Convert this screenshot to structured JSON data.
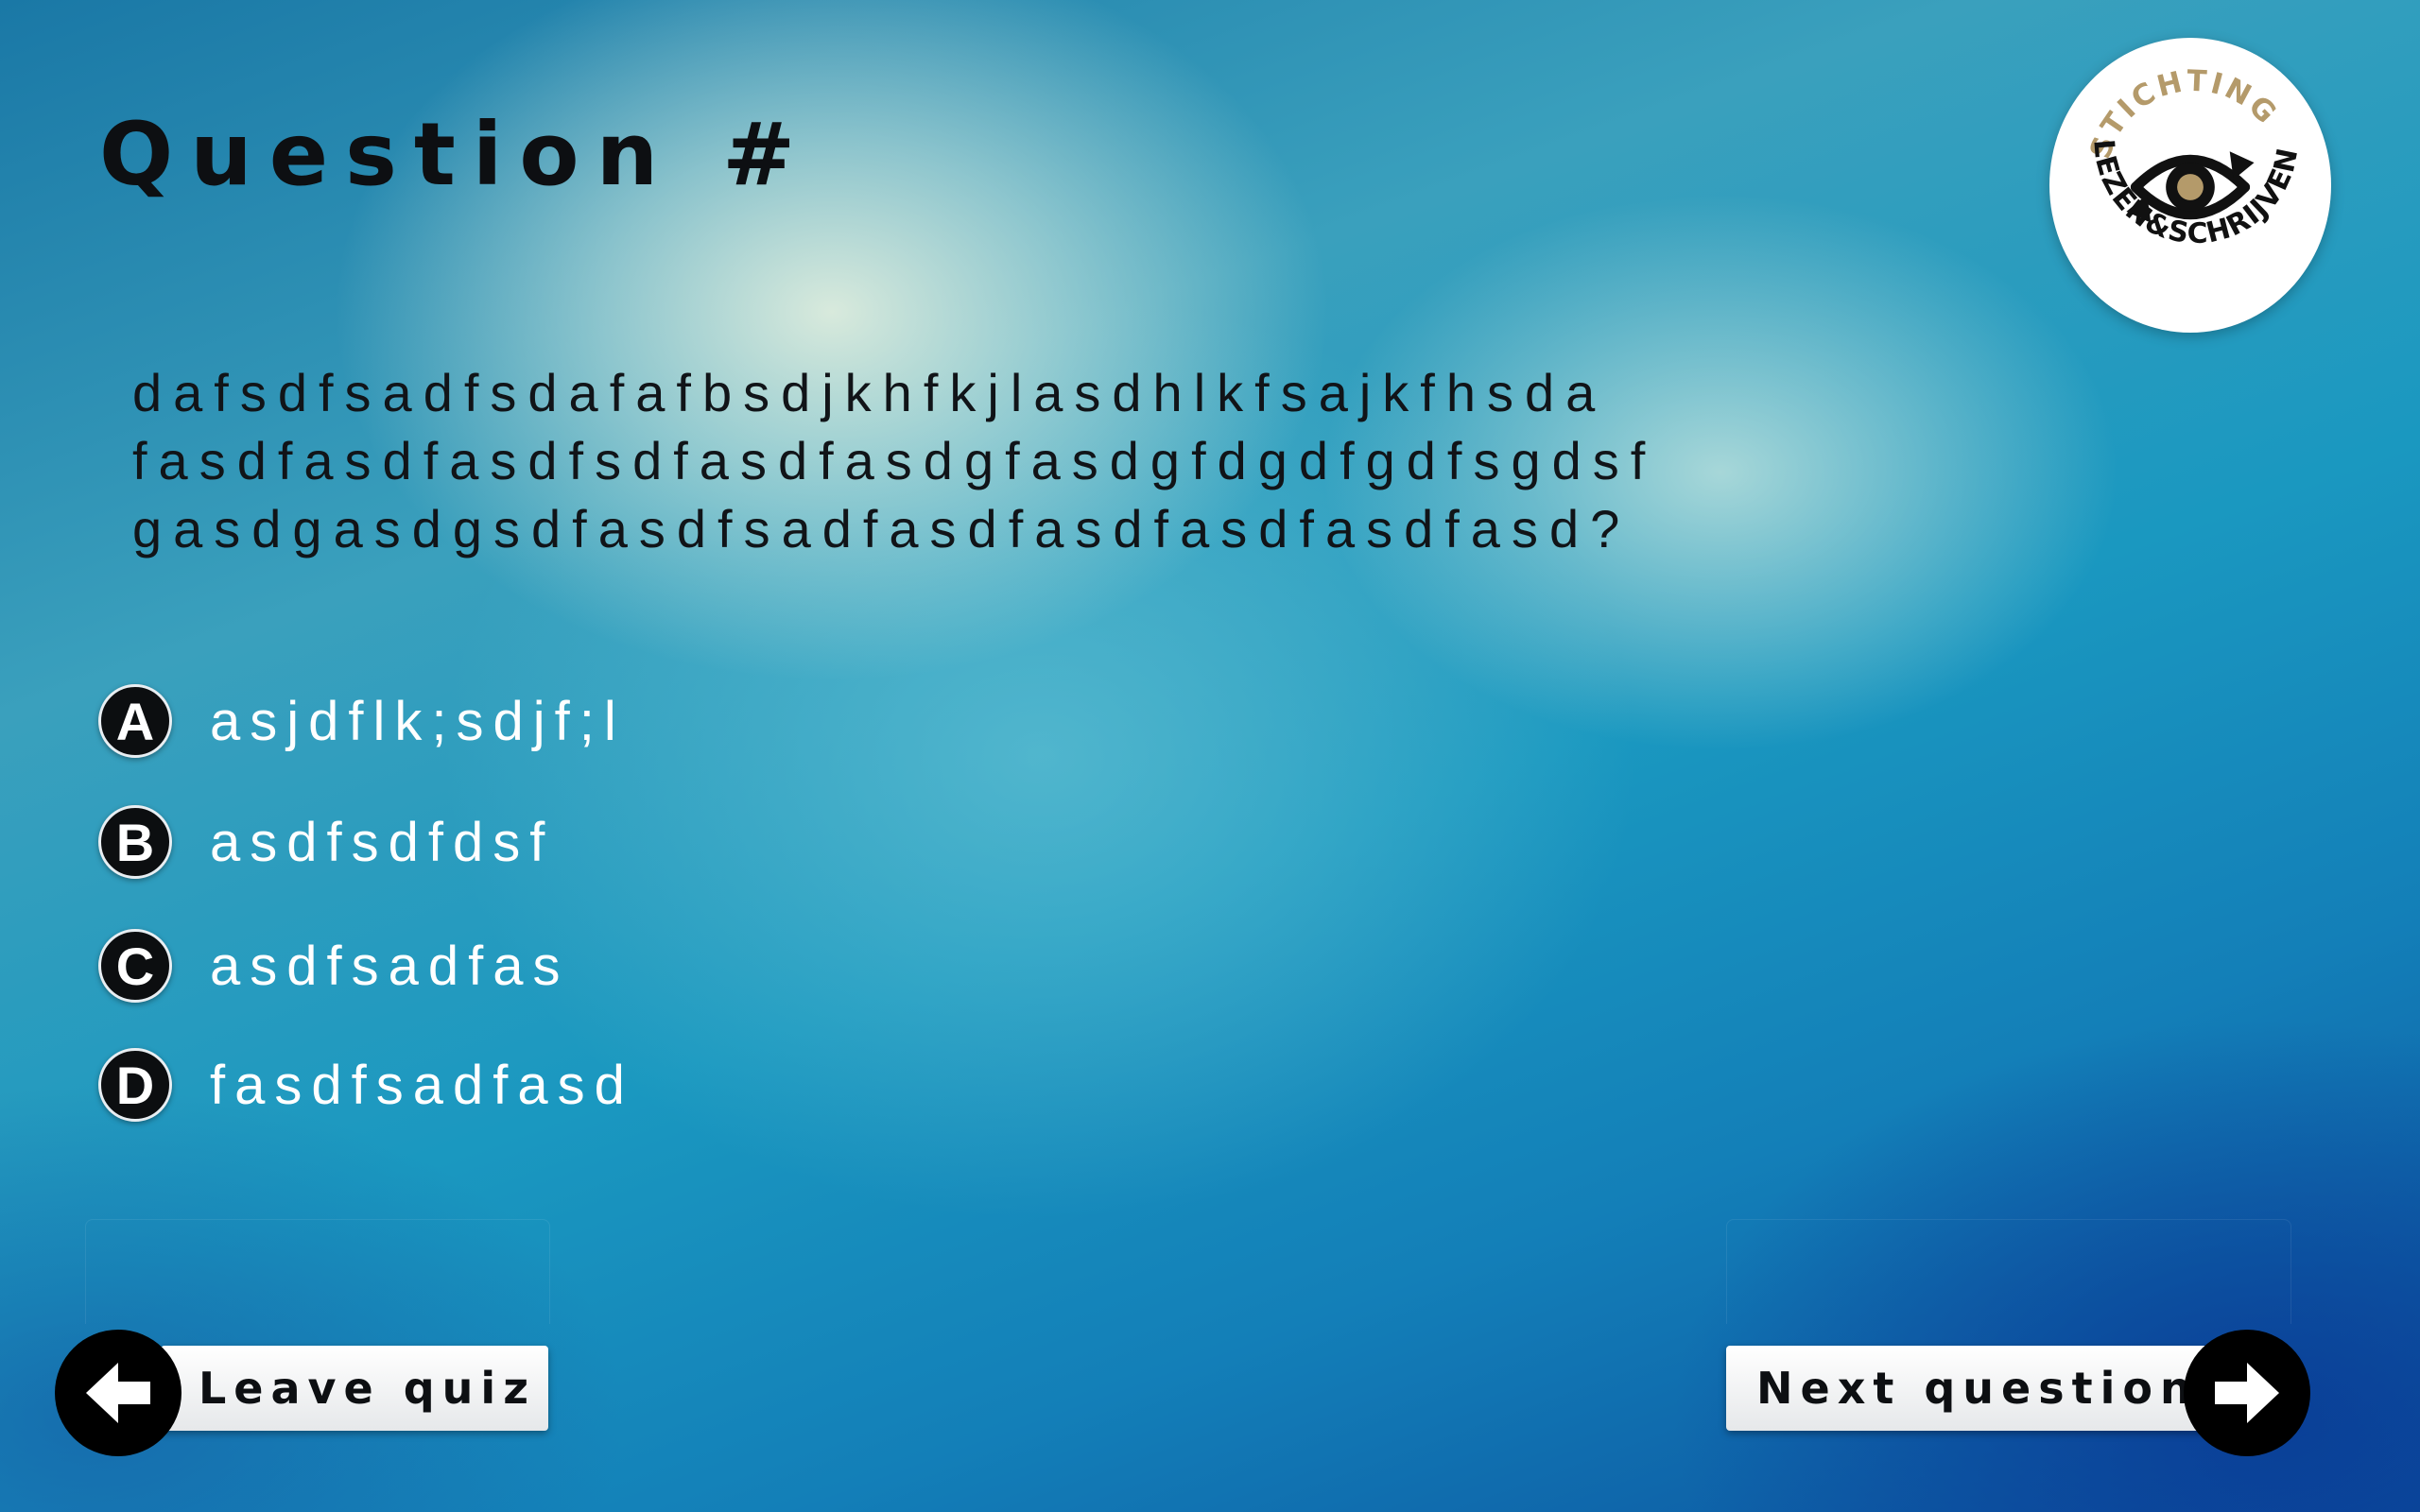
{
  "quiz": {
    "title": "Question #",
    "question_lines": [
      "dafsdfsadfsdafafbsdjkhfkjlasdhlkfsajkfhsda",
      "fasdfasdfasdfsdfasdfasdgfasdgfdgdfgdfsgdsf",
      "gasdgasdgsdfasdfsadfasdfasdfasdfasdfasd?"
    ],
    "answers": [
      {
        "letter": "A",
        "text": "asjdflk;sdjf;l"
      },
      {
        "letter": "B",
        "text": "asdfsdfdsf"
      },
      {
        "letter": "C",
        "text": "asdfsadfas"
      },
      {
        "letter": "D",
        "text": "fasdfsadfasd"
      }
    ]
  },
  "logo": {
    "top_text": "STICHTING",
    "bottom_text": "LEZEN&SCHRIJVEN",
    "icon": "eye-with-pen-nibs-icon",
    "accent_color": "#b49a6a"
  },
  "buttons": {
    "leave_label": "Leave quiz",
    "leave_icon": "arrow-left-icon",
    "next_label": "Next question",
    "next_icon": "arrow-right-icon"
  }
}
